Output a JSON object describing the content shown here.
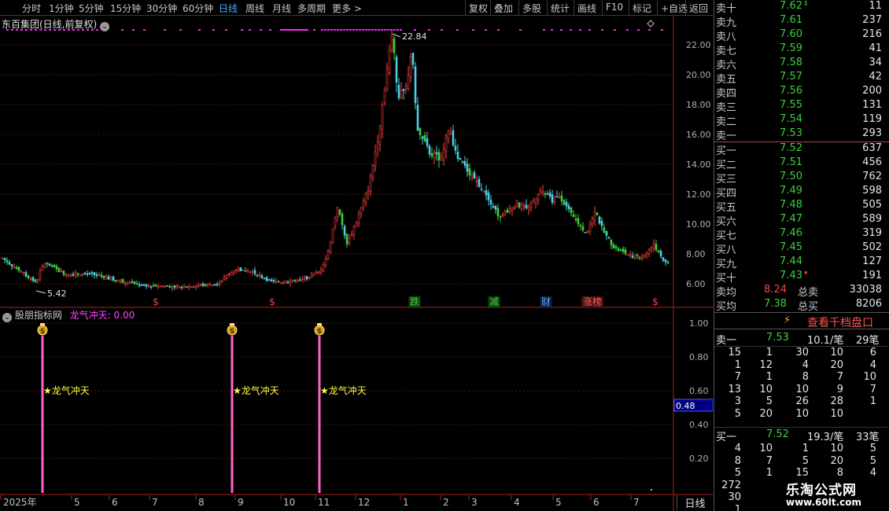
{
  "toolbar": {
    "periods": [
      "分时",
      "1分钟",
      "5分钟",
      "15分钟",
      "30分钟",
      "60分钟",
      "日线",
      "周线",
      "月线",
      "多周期",
      "更多 >"
    ],
    "active_period": "日线",
    "actions": [
      "复权",
      "叠加",
      "多股",
      "统计",
      "画线",
      "F10",
      "标记",
      "+自选",
      "返回"
    ]
  },
  "main_pane": {
    "title": "东百集团(日线,前复权)",
    "high_label": "22.84",
    "low_label": "5.42",
    "y_ticks": [
      "22.00",
      "20.00",
      "18.00",
      "16.00",
      "14.00",
      "12.00",
      "10.00",
      "8.00",
      "6.00"
    ],
    "event_markers": [
      {
        "text": "$",
        "color": "#ff4040"
      },
      {
        "text": "$",
        "color": "#ff4040"
      },
      {
        "text": "跌",
        "color": "#3cd03c"
      },
      {
        "text": "减",
        "color": "#3cd03c"
      },
      {
        "text": "财",
        "color": "#4da6ff"
      },
      {
        "text": "涨榜",
        "color": "#ff6060"
      },
      {
        "text": "$",
        "color": "#ff4040"
      }
    ]
  },
  "indicator_pane": {
    "title": "股朋指标网",
    "indicator_name": "龙气冲天: 0.00",
    "y_ticks": [
      "1.00",
      "0.80",
      "0.60",
      "0.40",
      "0.20"
    ],
    "crosshair_value": "0.48",
    "signal_text": "★龙气冲天",
    "signal_icon": "money-bag-icon"
  },
  "x_axis": {
    "labels": [
      "2025年",
      "5",
      "6",
      "7",
      "8",
      "9",
      "10",
      "11",
      "12",
      "1",
      "2",
      "3",
      "4",
      "5",
      "6",
      "7"
    ],
    "period_label": "日线"
  },
  "order_book": {
    "asks": [
      {
        "label": "卖十",
        "price": "7.62",
        "vol": "11",
        "mark": "‡"
      },
      {
        "label": "卖九",
        "price": "7.61",
        "vol": "237"
      },
      {
        "label": "卖八",
        "price": "7.60",
        "vol": "216"
      },
      {
        "label": "卖七",
        "price": "7.59",
        "vol": "41"
      },
      {
        "label": "卖六",
        "price": "7.58",
        "vol": "34"
      },
      {
        "label": "卖五",
        "price": "7.57",
        "vol": "42"
      },
      {
        "label": "卖四",
        "price": "7.56",
        "vol": "200"
      },
      {
        "label": "卖三",
        "price": "7.55",
        "vol": "131"
      },
      {
        "label": "卖二",
        "price": "7.54",
        "vol": "119"
      },
      {
        "label": "卖一",
        "price": "7.53",
        "vol": "293"
      }
    ],
    "bids": [
      {
        "label": "买一",
        "price": "7.52",
        "vol": "637"
      },
      {
        "label": "买二",
        "price": "7.51",
        "vol": "456"
      },
      {
        "label": "买三",
        "price": "7.50",
        "vol": "762"
      },
      {
        "label": "买四",
        "price": "7.49",
        "vol": "598"
      },
      {
        "label": "买五",
        "price": "7.48",
        "vol": "505"
      },
      {
        "label": "买六",
        "price": "7.47",
        "vol": "589"
      },
      {
        "label": "买七",
        "price": "7.46",
        "vol": "319"
      },
      {
        "label": "买八",
        "price": "7.45",
        "vol": "502"
      },
      {
        "label": "买九",
        "price": "7.44",
        "vol": "127"
      },
      {
        "label": "买十",
        "price": "7.43",
        "vol": "191",
        "mark": "▾"
      }
    ],
    "avg_sell": {
      "label": "卖均",
      "price": "8.24",
      "total_label": "总卖",
      "total": "33038"
    },
    "avg_buy": {
      "label": "买均",
      "price": "7.38",
      "total_label": "总买",
      "total": "8206"
    }
  },
  "depth_button": {
    "label": "查看千档盘口"
  },
  "queue": {
    "sell": {
      "label": "卖一",
      "price": "7.53",
      "per_order": "10.1/笔",
      "orders": "29笔",
      "rows": [
        [
          "15",
          "1",
          "30",
          "10",
          "6"
        ],
        [
          "1",
          "12",
          "4",
          "20",
          "4"
        ],
        [
          "7",
          "1",
          "8",
          "7",
          "10"
        ],
        [
          "13",
          "10",
          "10",
          "9",
          "7"
        ],
        [
          "3",
          "5",
          "26",
          "28",
          "1"
        ],
        [
          "5",
          "20",
          "10",
          "10",
          ""
        ]
      ]
    },
    "buy": {
      "label": "买一",
      "price": "7.52",
      "per_order": "19.3/笔",
      "orders": "33笔",
      "rows": [
        [
          "4",
          "10",
          "1",
          "10",
          "5"
        ],
        [
          "8",
          "7",
          "5",
          "20",
          "5"
        ],
        [
          "5",
          "1",
          "15",
          "8",
          "4"
        ],
        [
          "272",
          "",
          "",
          "",
          ""
        ],
        [
          "30",
          "",
          "",
          "",
          ""
        ],
        [
          "1",
          "",
          "",
          "",
          ""
        ]
      ]
    }
  },
  "watermark": {
    "line1": "乐淘公式网",
    "line2": "www.60lt.com"
  },
  "colors": {
    "up": "#ff4040",
    "down": "#3cd03c",
    "neutral": "#4dd0e1",
    "signal_bar": "#ff66cc",
    "accent": "#4da6ff"
  }
}
